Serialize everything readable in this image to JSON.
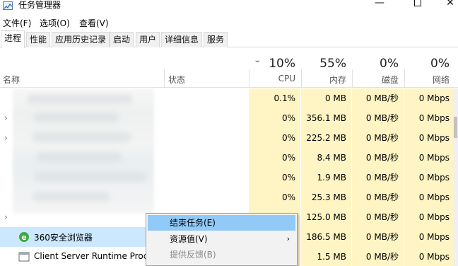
{
  "window": {
    "title": "任务管理器"
  },
  "menu": [
    "文件(F)",
    "选项(O)",
    "查看(V)"
  ],
  "tabs": [
    "进程",
    "性能",
    "应用历史记录",
    "启动",
    "用户",
    "详细信息",
    "服务"
  ],
  "columns": {
    "name": "名称",
    "status": "状态",
    "cpu": {
      "pct": "10%",
      "label": "CPU"
    },
    "memory": {
      "pct": "55%",
      "label": "内存"
    },
    "disk": {
      "pct": "0%",
      "label": "磁盘"
    },
    "network": {
      "pct": "0%",
      "label": "网络"
    }
  },
  "rows": [
    {
      "name": "",
      "cpu": "0.1%",
      "mem": "0 MB",
      "disk": "0 MB/秒",
      "net": "0 Mbps"
    },
    {
      "name": "",
      "cpu": "0%",
      "mem": "356.1 MB",
      "disk": "0 MB/秒",
      "net": "0 Mbps"
    },
    {
      "name": "",
      "cpu": "0%",
      "mem": "225.2 MB",
      "disk": "0 MB/秒",
      "net": "0 Mbps"
    },
    {
      "name": "",
      "cpu": "0%",
      "mem": "8.4 MB",
      "disk": "0 MB/秒",
      "net": "0 Mbps"
    },
    {
      "name": "",
      "cpu": "0%",
      "mem": "1.9 MB",
      "disk": "0 MB/秒",
      "net": "0 Mbps"
    },
    {
      "name": "",
      "cpu": "0%",
      "mem": "25.3 MB",
      "disk": "0 MB/秒",
      "net": "0 Mbps"
    },
    {
      "name": "",
      "cpu": "",
      "mem": "125.0 MB",
      "disk": "0 MB/秒",
      "net": "0 Mbps"
    },
    {
      "name": "360安全浏览器",
      "cpu": "",
      "mem": "186.5 MB",
      "disk": "0 MB/秒",
      "net": "0 Mbps"
    },
    {
      "name": "Client Server Runtime Proce",
      "cpu": "",
      "mem": "1.5 MB",
      "disk": "0 MB/秒",
      "net": "0 Mbps"
    }
  ],
  "context_menu": {
    "items": [
      {
        "label": "结束任务(E)"
      },
      {
        "label": "资源值(V)"
      },
      {
        "label": "提供反馈(B)"
      }
    ],
    "submenu_arrow": "›"
  },
  "colors": {
    "heat": "#fff4c4",
    "highlight": "#91c9f7",
    "selected": "#cce8ff"
  }
}
